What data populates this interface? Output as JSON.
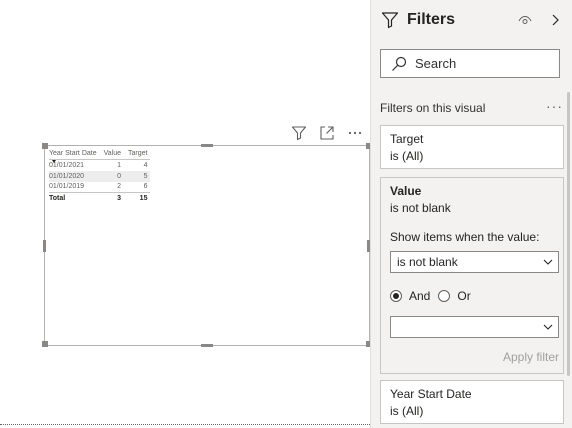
{
  "visual": {
    "table": {
      "headers": [
        "Year Start Date",
        "Value",
        "Target"
      ],
      "rows": [
        [
          "01/01/2021",
          "1",
          "4"
        ],
        [
          "01/01/2020",
          "0",
          "5"
        ],
        [
          "01/01/2019",
          "2",
          "6"
        ]
      ],
      "total": [
        "Total",
        "3",
        "15"
      ]
    },
    "toolbar": {
      "more": "···"
    }
  },
  "filters_pane": {
    "title": "Filters",
    "search_placeholder": "Search",
    "section_label": "Filters on this visual",
    "section_more": "···",
    "cards": [
      {
        "name": "Target",
        "state": "is (All)"
      },
      {
        "name": "Value",
        "state": "is not blank",
        "show_items_label": "Show items when the value:",
        "condition": "is not blank",
        "and_label": "And",
        "or_label": "Or",
        "second_condition": "",
        "apply_label": "Apply filter"
      },
      {
        "name": "Year Start Date",
        "state": "is (All)"
      }
    ]
  }
}
